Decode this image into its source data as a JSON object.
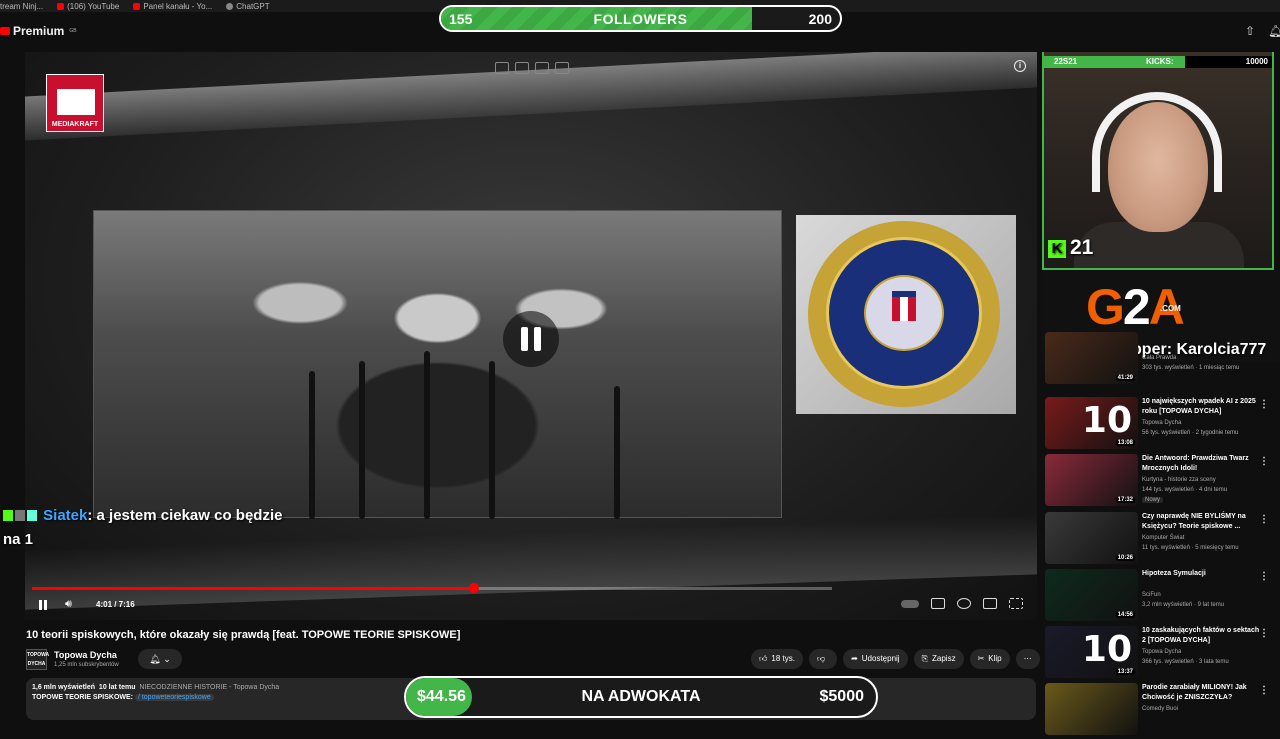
{
  "bookmarks": [
    {
      "label": "tream Ninj..."
    },
    {
      "label": "(106) YouTube"
    },
    {
      "label": "Panel kanału - Yo..."
    },
    {
      "label": "ChatGPT"
    }
  ],
  "header": {
    "logo_text": "Premium",
    "region": "GB"
  },
  "followers_goal": {
    "current": "155",
    "label": "FOLLOWERS",
    "target": "200",
    "progress": 0.78
  },
  "player": {
    "channel_logo_text": "MEDIAKRAFT",
    "chat": {
      "username": "Siatek",
      "message": ": a jestem ciekaw co będzie na 1"
    },
    "time": "4:01 / 7:16",
    "progress": 0.553
  },
  "video": {
    "title": "10 teorii spiskowych, które okazały się prawdą [feat. TOPOWE TEORIE SPISKOWE]",
    "channel_avatar_text": "TOPOWA DYCHA",
    "channel": "Topowa Dycha",
    "subscribers": "1,25 mln subskrybentów",
    "likes": "18 tys.",
    "share": "Udostępnij",
    "save": "Zapisz",
    "clip": "Klip"
  },
  "description": {
    "views": "1,6 mln wyświetleń",
    "age": "10 lat temu",
    "tagline": "NIECODZIENNE HISTORIE - Topowa Dycha",
    "line2": "TOPOWE TEORIE SPISKOWE:",
    "channel_tag": "/ topoweteoriespiskowe"
  },
  "donation_goal": {
    "current": "$44.56",
    "label": "NA ADWOKATA",
    "target": "$5000",
    "progress": 0.0089
  },
  "kick": {
    "left": "22S21",
    "mid": "KICKS:",
    "right": "10000",
    "progress": 0.62,
    "count": "21"
  },
  "sponsor": {
    "tipper": "Najlepszy tipper: Karolcia777"
  },
  "recommendations": [
    {
      "title": "",
      "channel": "Cała Prawda",
      "meta": "303 tys. wyświetleń · 1 miesiąc temu",
      "duration": "41:29",
      "big": "",
      "thumb_color": "#4a2a1a"
    },
    {
      "title": "10 największych wpadek AI z 2025 roku [TOPOWA DYCHA]",
      "channel": "Topowa Dycha",
      "meta": "56 tys. wyświetleń · 2 tygodnie temu",
      "duration": "13:08",
      "big": "10",
      "thumb_color": "#7a1a1a"
    },
    {
      "title": "Die Antwoord: Prawdziwa Twarz Mrocznych Idoli!",
      "channel": "Kurtyna - historie zza sceny",
      "meta": "144 tys. wyświetleń · 4 dni temu",
      "duration": "17:32",
      "big": "",
      "thumb_color": "#8a2a3a",
      "new": "Nowy"
    },
    {
      "title": "Czy naprawdę NIE BYLIŚMY na Księżycu? Teorie spiskowe ...",
      "channel": "Komputer Świat",
      "meta": "11 tys. wyświetleń · 5 miesięcy temu",
      "duration": "10:26",
      "big": "",
      "thumb_color": "#3a3a3a"
    },
    {
      "title": "Hipoteza Symulacji",
      "channel": "SciFun",
      "meta": "3,2 mln wyświetleń · 9 lat temu",
      "duration": "14:56",
      "big": "",
      "thumb_color": "#0e2a1e"
    },
    {
      "title": "10 zaskakujących faktów o sektach 2 [TOPOWA DYCHA]",
      "channel": "Topowa Dycha",
      "meta": "366 tys. wyświetleń · 3 lata temu",
      "duration": "13:37",
      "big": "10",
      "thumb_color": "#1a1a2a"
    },
    {
      "title": "Parodie zarabiały MILIONY! Jak Chciwość je ZNISZCZYŁA?",
      "channel": "Comedy Buoi",
      "meta": "",
      "duration": "",
      "big": "",
      "thumb_color": "#6a5a1a"
    }
  ]
}
